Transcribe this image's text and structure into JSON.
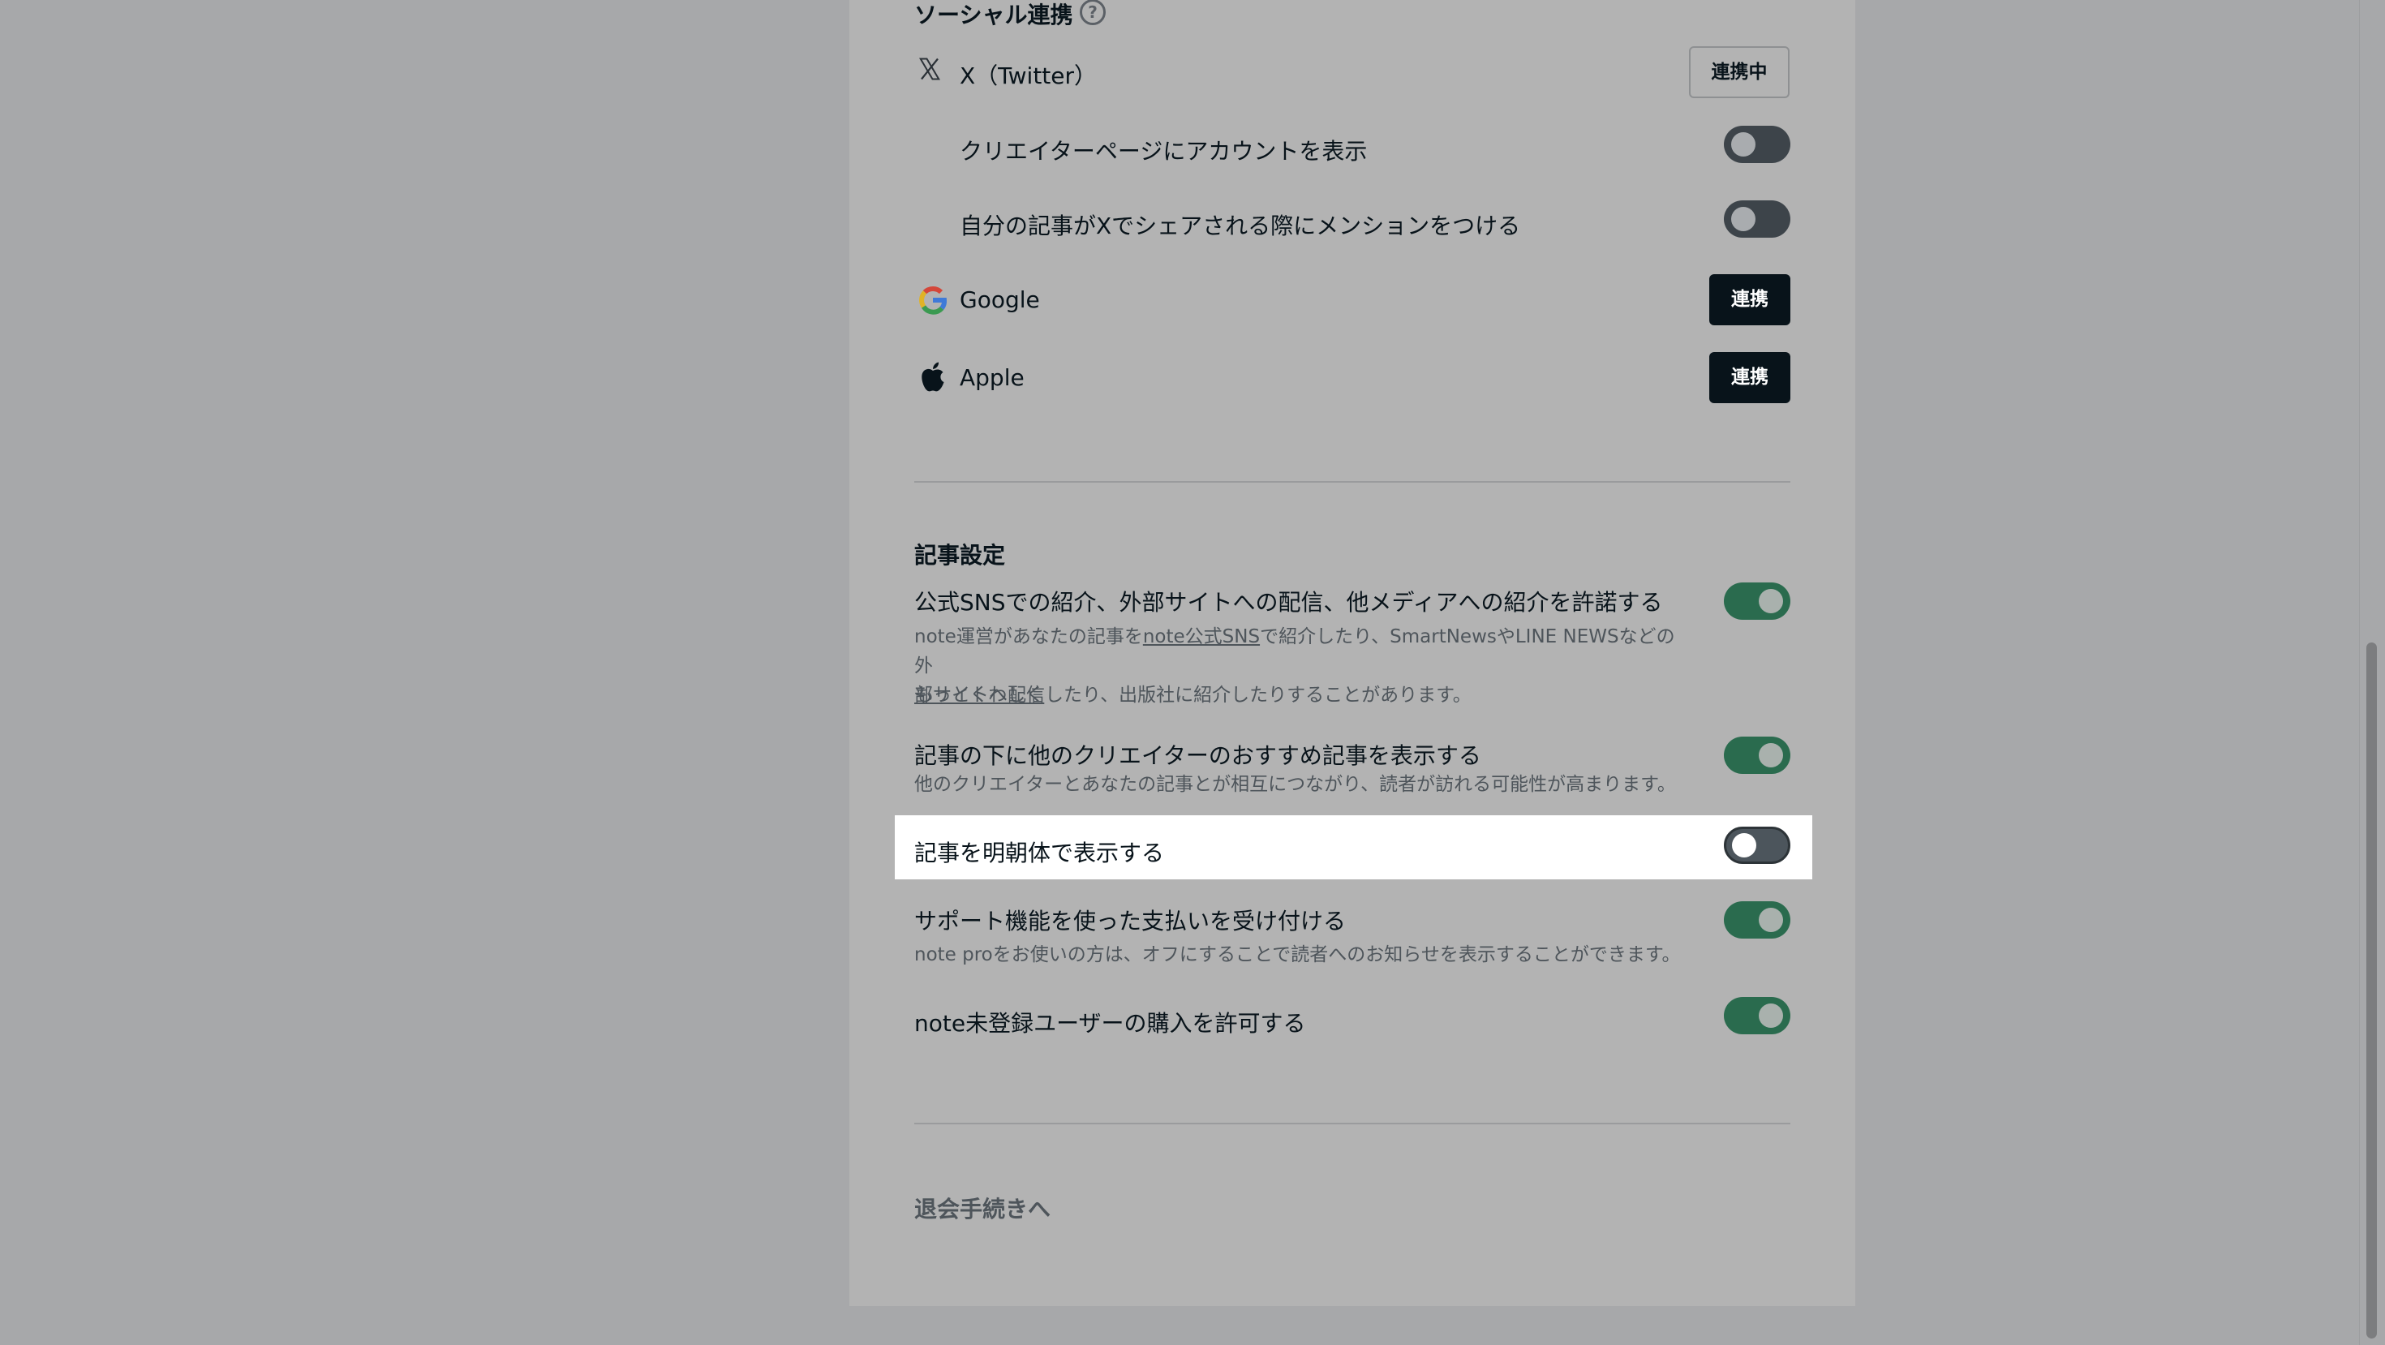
{
  "social": {
    "title": "ソーシャル連携",
    "help_icon": "question-circle-icon",
    "x": {
      "label": "X（Twitter）",
      "icon": "x-logo-icon",
      "button": "連携中",
      "options": [
        {
          "label": "クリエイターページにアカウントを表示",
          "enabled": false
        },
        {
          "label": "自分の記事がXでシェアされる際にメンションをつける",
          "enabled": false
        }
      ]
    },
    "google": {
      "label": "Google",
      "icon": "google-logo-icon",
      "button": "連携"
    },
    "apple": {
      "label": "Apple",
      "icon": "apple-logo-icon",
      "button": "連携"
    }
  },
  "article": {
    "title": "記事設定",
    "items": [
      {
        "label": "公式SNSでの紹介、外部サイトへの配信、他メディアへの紹介を許諾する",
        "desc_prefix": "note運営があなたの記事を",
        "desc_link": "note公式SNS",
        "desc_suffix_1": "で紹介したり、SmartNewsやLINE NEWSなどの外",
        "desc_line_2": "部サイトへ配信したり、出版社に紹介したりすることがあります。",
        "more_link": "もっとくわしく",
        "enabled": true
      },
      {
        "label": "記事の下に他のクリエイターのおすすめ記事を表示する",
        "desc": "他のクリエイターとあなたの記事とが相互につながり、読者が訪れる可能性が高まります。",
        "enabled": true
      },
      {
        "label": "記事を明朝体で表示する",
        "enabled": false,
        "highlighted": true
      },
      {
        "label": "サポート機能を使った支払いを受け付ける",
        "desc": "note proをお使いの方は、オフにすることで読者へのお知らせを表示することができます。",
        "enabled": true
      },
      {
        "label": "note未登録ユーザーの購入を許可する",
        "enabled": true
      }
    ]
  },
  "leave": {
    "label": "退会手続きへ"
  },
  "colors": {
    "overlay": "#a7a8aa",
    "card": "#b3b3b3",
    "toggle_on": "#2a6b4e",
    "toggle_off": "#3d444a",
    "button_dark": "#08131a",
    "highlight": "#ffffff"
  }
}
